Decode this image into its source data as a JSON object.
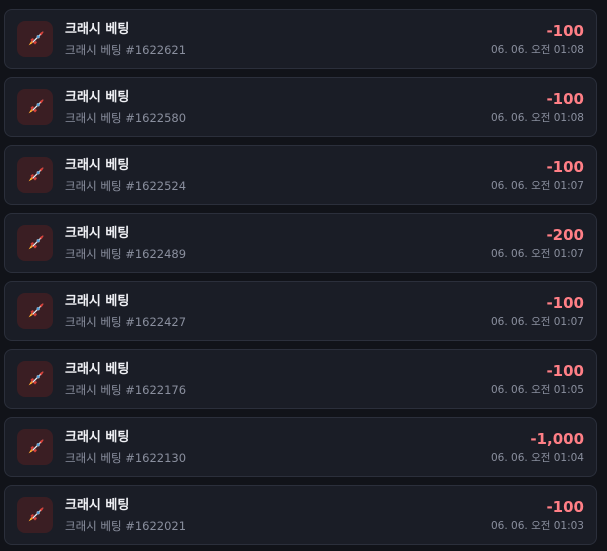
{
  "transactions": [
    {
      "title": "크래시 베팅",
      "subtitle": "크래시 베팅 #1622621",
      "amount": "-100",
      "time": "06. 06. 오전 01:08",
      "icon": "rocket-icon"
    },
    {
      "title": "크래시 베팅",
      "subtitle": "크래시 베팅 #1622580",
      "amount": "-100",
      "time": "06. 06. 오전 01:08",
      "icon": "rocket-icon"
    },
    {
      "title": "크래시 베팅",
      "subtitle": "크래시 베팅 #1622524",
      "amount": "-100",
      "time": "06. 06. 오전 01:07",
      "icon": "rocket-icon"
    },
    {
      "title": "크래시 베팅",
      "subtitle": "크래시 베팅 #1622489",
      "amount": "-200",
      "time": "06. 06. 오전 01:07",
      "icon": "rocket-icon"
    },
    {
      "title": "크래시 베팅",
      "subtitle": "크래시 베팅 #1622427",
      "amount": "-100",
      "time": "06. 06. 오전 01:07",
      "icon": "rocket-icon"
    },
    {
      "title": "크래시 베팅",
      "subtitle": "크래시 베팅 #1622176",
      "amount": "-100",
      "time": "06. 06. 오전 01:05",
      "icon": "rocket-icon"
    },
    {
      "title": "크래시 베팅",
      "subtitle": "크래시 베팅 #1622130",
      "amount": "-1,000",
      "time": "06. 06. 오전 01:04",
      "icon": "rocket-icon"
    },
    {
      "title": "크래시 베팅",
      "subtitle": "크래시 베팅 #1622021",
      "amount": "-100",
      "time": "06. 06. 오전 01:03",
      "icon": "rocket-icon"
    }
  ],
  "colors": {
    "background": "#111319",
    "card": "#1a1d26",
    "card_border": "#2b2f3b",
    "icon_bg": "#3a1e23",
    "amount_negative": "#ff7f86",
    "muted_text": "#8a8f9e"
  }
}
